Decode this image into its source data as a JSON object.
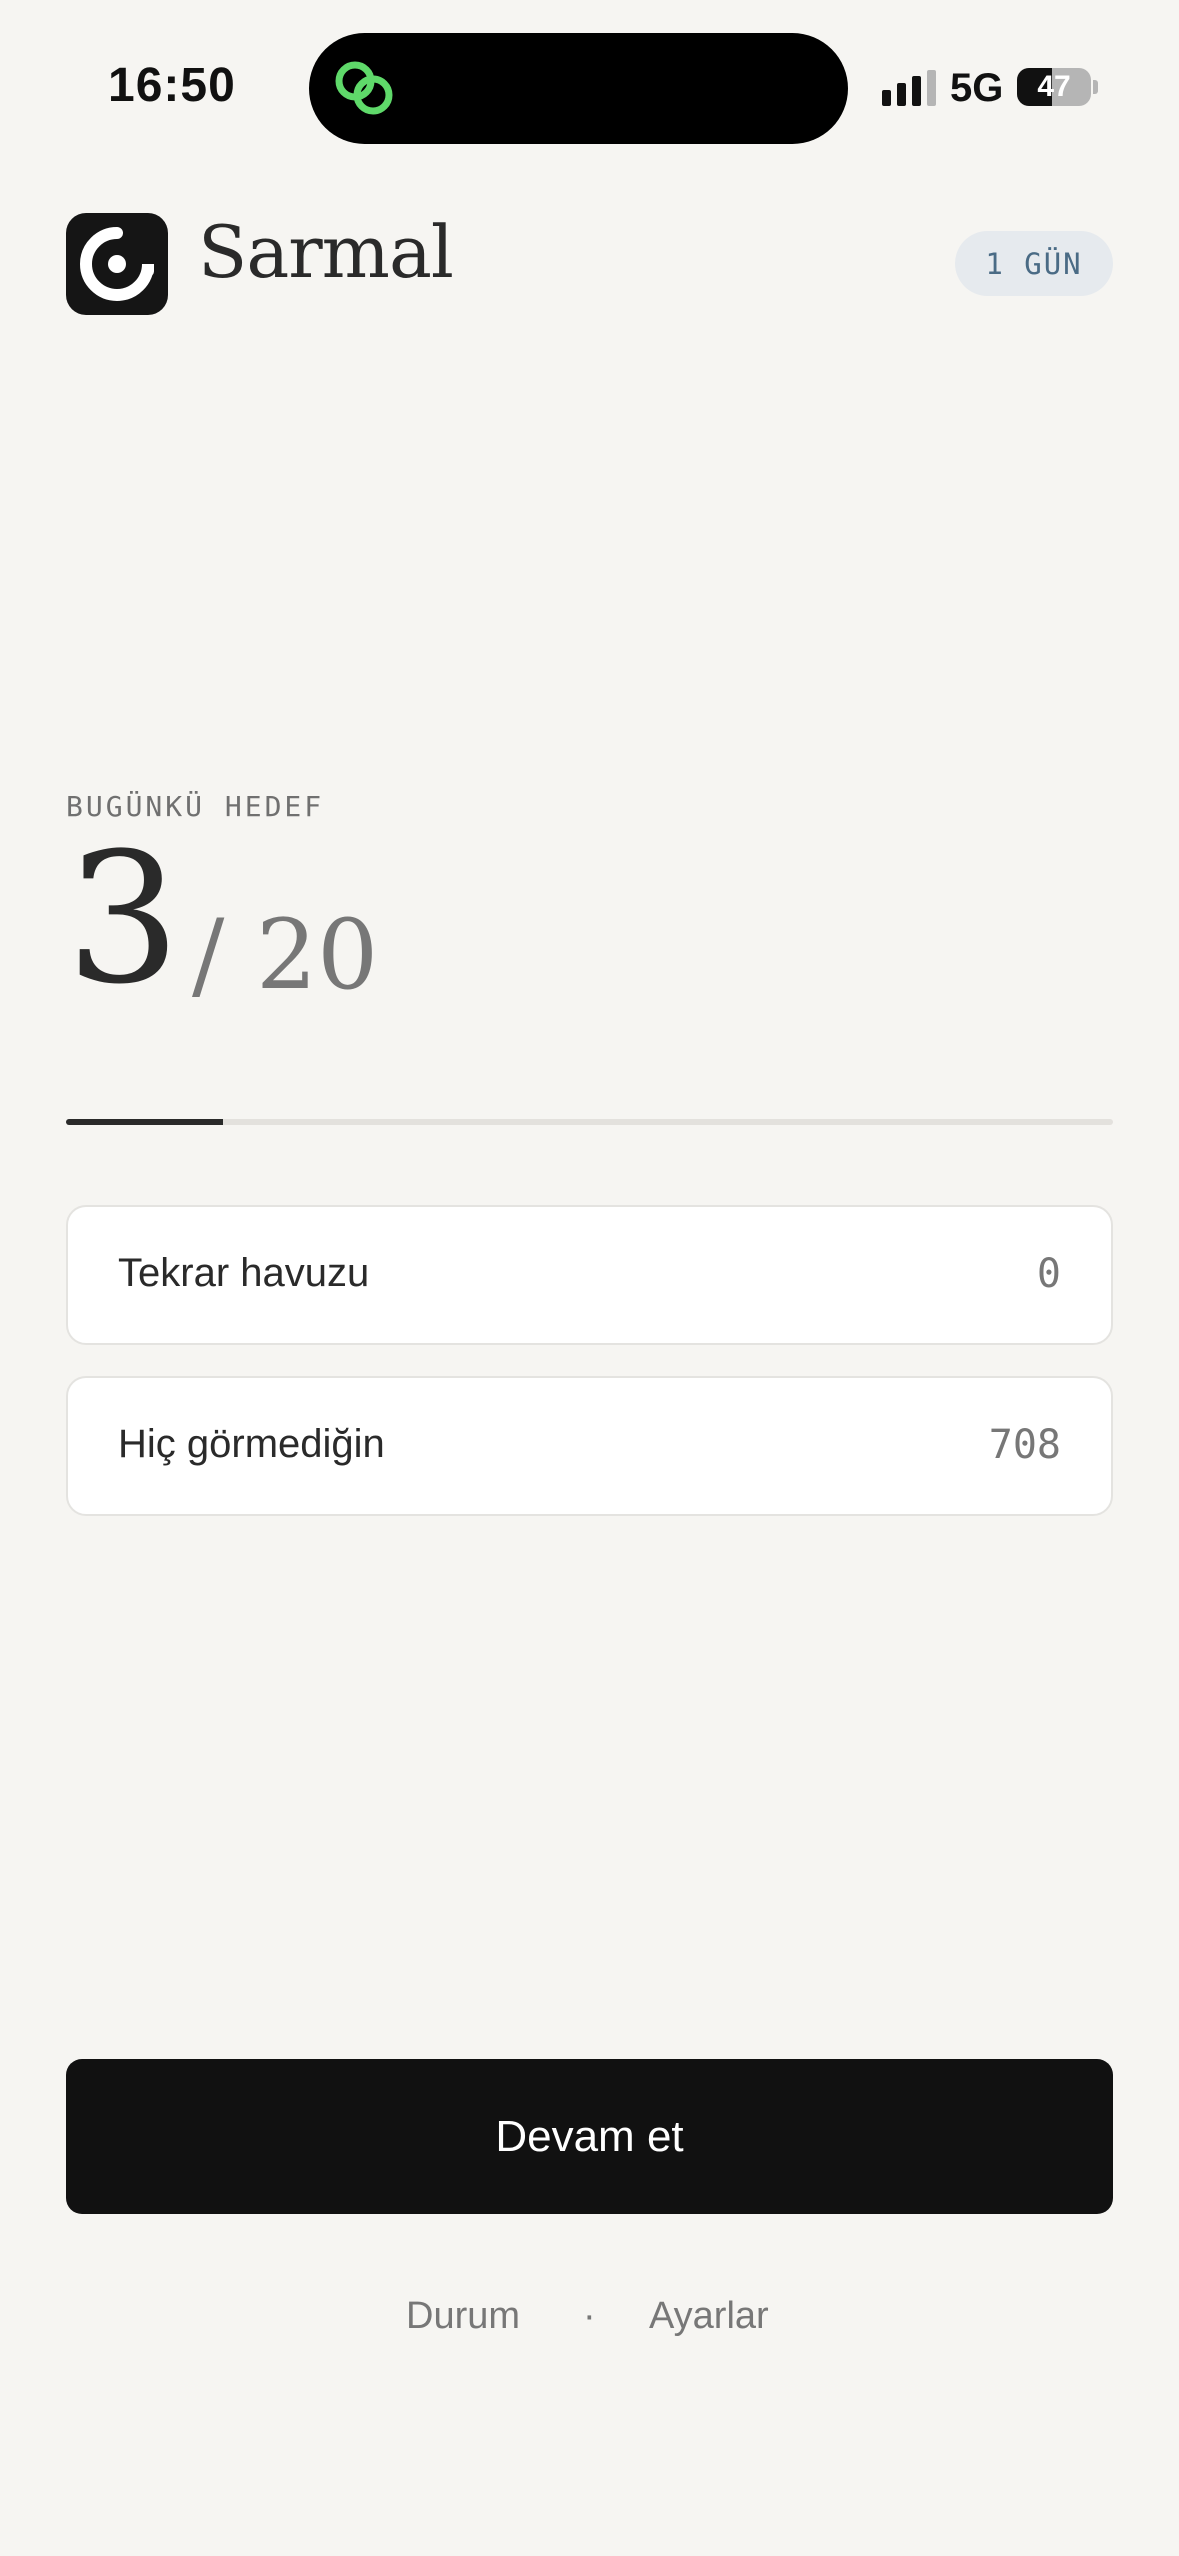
{
  "status_bar": {
    "time": "16:50",
    "network": "5G",
    "battery_percent": 47,
    "battery_label": "47",
    "island_icon": "link-rings-icon",
    "island_icon_color": "#5fd96a"
  },
  "header": {
    "app_title": "Sarmal",
    "logo_icon": "spiral-logo-icon",
    "streak_badge": "1 GÜN"
  },
  "goal": {
    "label": "BUGÜNKÜ HEDEF",
    "current": "3",
    "separator": "/",
    "total": "20",
    "progress_fraction": 0.15
  },
  "stats": [
    {
      "label": "Tekrar havuzu",
      "value": "0"
    },
    {
      "label": "Hiç görmediğin",
      "value": "708"
    }
  ],
  "actions": {
    "continue_label": "Devam et"
  },
  "footer": {
    "status_label": "Durum",
    "dot": "·",
    "settings_label": "Ayarlar"
  },
  "colors": {
    "background": "#f6f5f2",
    "accent": "#111111",
    "badge_background": "#e6eaee",
    "badge_text": "#4a6b85"
  }
}
